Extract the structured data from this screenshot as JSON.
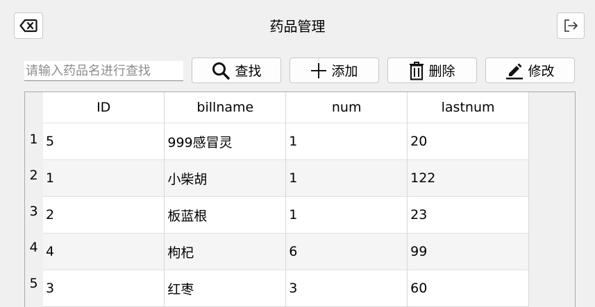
{
  "window": {
    "title": "药品管理"
  },
  "toolbar": {
    "back_icon": "backspace-icon",
    "exit_icon": "logout-icon",
    "search_placeholder": "请输入药品名进行查找",
    "search_value": "",
    "buttons": [
      {
        "label": "查找",
        "icon": "search-icon"
      },
      {
        "label": "添加",
        "icon": "plus-icon"
      },
      {
        "label": "删除",
        "icon": "trash-icon"
      },
      {
        "label": "修改",
        "icon": "edit-icon"
      }
    ]
  },
  "table": {
    "columns": [
      "ID",
      "billname",
      "num",
      "lastnum"
    ],
    "row_headers": [
      "1",
      "2",
      "3",
      "4",
      "5"
    ],
    "rows": [
      [
        "5",
        "999感冒灵",
        "1",
        "20"
      ],
      [
        "1",
        "小柴胡",
        "1",
        "122"
      ],
      [
        "2",
        "板蓝根",
        "1",
        "23"
      ],
      [
        "4",
        "枸杞",
        "6",
        "99"
      ],
      [
        "3",
        "红枣",
        "3",
        "60"
      ]
    ]
  }
}
